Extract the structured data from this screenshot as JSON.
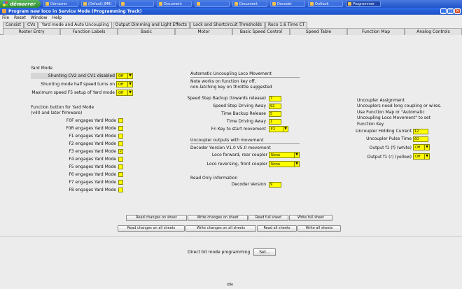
{
  "taskbar": {
    "start_label": "démarrer",
    "tasks": [
      "Démarrer",
      "(Defaut) JMRI",
      "",
      "Document",
      "",
      "Document",
      "Decoder",
      "Outlook",
      "Programmer"
    ]
  },
  "window": {
    "title": "Program new loco in Service Mode (Programming Track)"
  },
  "menu": [
    "File",
    "Reset",
    "Window",
    "Help"
  ],
  "tabs_row1": [
    "Consist",
    "CVs",
    "Yard mode and Auto Uncoupling",
    "Output Dimming and Light Effects",
    "Lock and Shortcircuit Thresholds",
    "Roco 1.6 Time CT"
  ],
  "tabs_row2": [
    "Roster Entry",
    "Function Labels",
    "Basic",
    "Motor",
    "Basic Speed Control",
    "Speed Table",
    "Function Map",
    "Analog Controls"
  ],
  "yard": {
    "header": "Yard Mode",
    "rows": [
      {
        "label": "Shunting CV2 and CV1 disabled",
        "value": "Off"
      },
      {
        "label": "Shunting mode half speed turns on",
        "value": "Off"
      },
      {
        "label": "Maximum speed F5 setup of Yard mode",
        "value": "Off"
      }
    ],
    "fn_header1": "Function button for Yard Mode",
    "fn_header2": "(v40 and later firmware)",
    "fn_rows": [
      {
        "label": "F0F engages Yard Mode",
        "checked": ""
      },
      {
        "label": "F0R engages Yard Mode",
        "checked": ""
      },
      {
        "label": "F1 engages Yard Mode",
        "checked": ""
      },
      {
        "label": "F2 engages Yard Mode",
        "checked": ""
      },
      {
        "label": "F3 engages Yard Mode",
        "checked": "✓"
      },
      {
        "label": "F4 engages Yard Mode",
        "checked": ""
      },
      {
        "label": "F5 engages Yard Mode",
        "checked": ""
      },
      {
        "label": "F6 engages Yard Mode",
        "checked": ""
      },
      {
        "label": "F7 engages Yard Mode",
        "checked": ""
      },
      {
        "label": "F8 engages Yard Mode",
        "checked": ""
      }
    ]
  },
  "auto": {
    "header": "Automatic Uncoupling Loco Movement",
    "note1": "Note works on function key off,",
    "note2": "non-latching key on throttle suggested",
    "rows": [
      {
        "label": "Speed Step Backup (towards release)",
        "value": "7"
      },
      {
        "label": "Speed Step Driving Away",
        "value": "92"
      },
      {
        "label": "Time Backup Release",
        "value": "5"
      },
      {
        "label": "Time Driving Away",
        "value": "1"
      }
    ],
    "fnkey_label": "Fn Key to start movement",
    "fnkey_value": "F2",
    "outputs_header": "Uncoupler outputs with movement",
    "outputs_sub": "Decoder Version V1.0 V5.0 movement",
    "out_rows": [
      {
        "label": "Loco forward, rear coupler",
        "value": "None"
      },
      {
        "label": "Loco reversing, front coupler",
        "value": "None"
      }
    ],
    "readonly_header": "Read Only information",
    "decoder_label": "Decoder Version",
    "decoder_value": "9"
  },
  "uncoupler": {
    "header": "Uncoupler Assignment",
    "note1": "Uncouplers need long coupling or wires.",
    "note2": "Use Function Map or \"Automatic",
    "note3": "Uncoupling Loco Movement\" to set",
    "note4": "Function Key",
    "rows": [
      {
        "label": "Uncoupler Holding Current",
        "value": "12"
      },
      {
        "label": "Uncoupler Pulse Time",
        "value": "60"
      }
    ],
    "out_rows": [
      {
        "label": "Output f1 (f) (white)",
        "value": "Off"
      },
      {
        "label": "Output f1 (r) (yellow)",
        "value": "Off"
      }
    ]
  },
  "buttons": {
    "row1": [
      "Read changes on sheet",
      "Write changes on sheet",
      "Read full sheet",
      "Write full sheet"
    ],
    "row2": [
      "Read changes on all sheets",
      "Write changes on all sheets",
      "Read all sheets",
      "Write all sheets"
    ]
  },
  "programming": {
    "label": "Direct bit mode programming",
    "set_label": "Set..."
  },
  "status": "Idle"
}
